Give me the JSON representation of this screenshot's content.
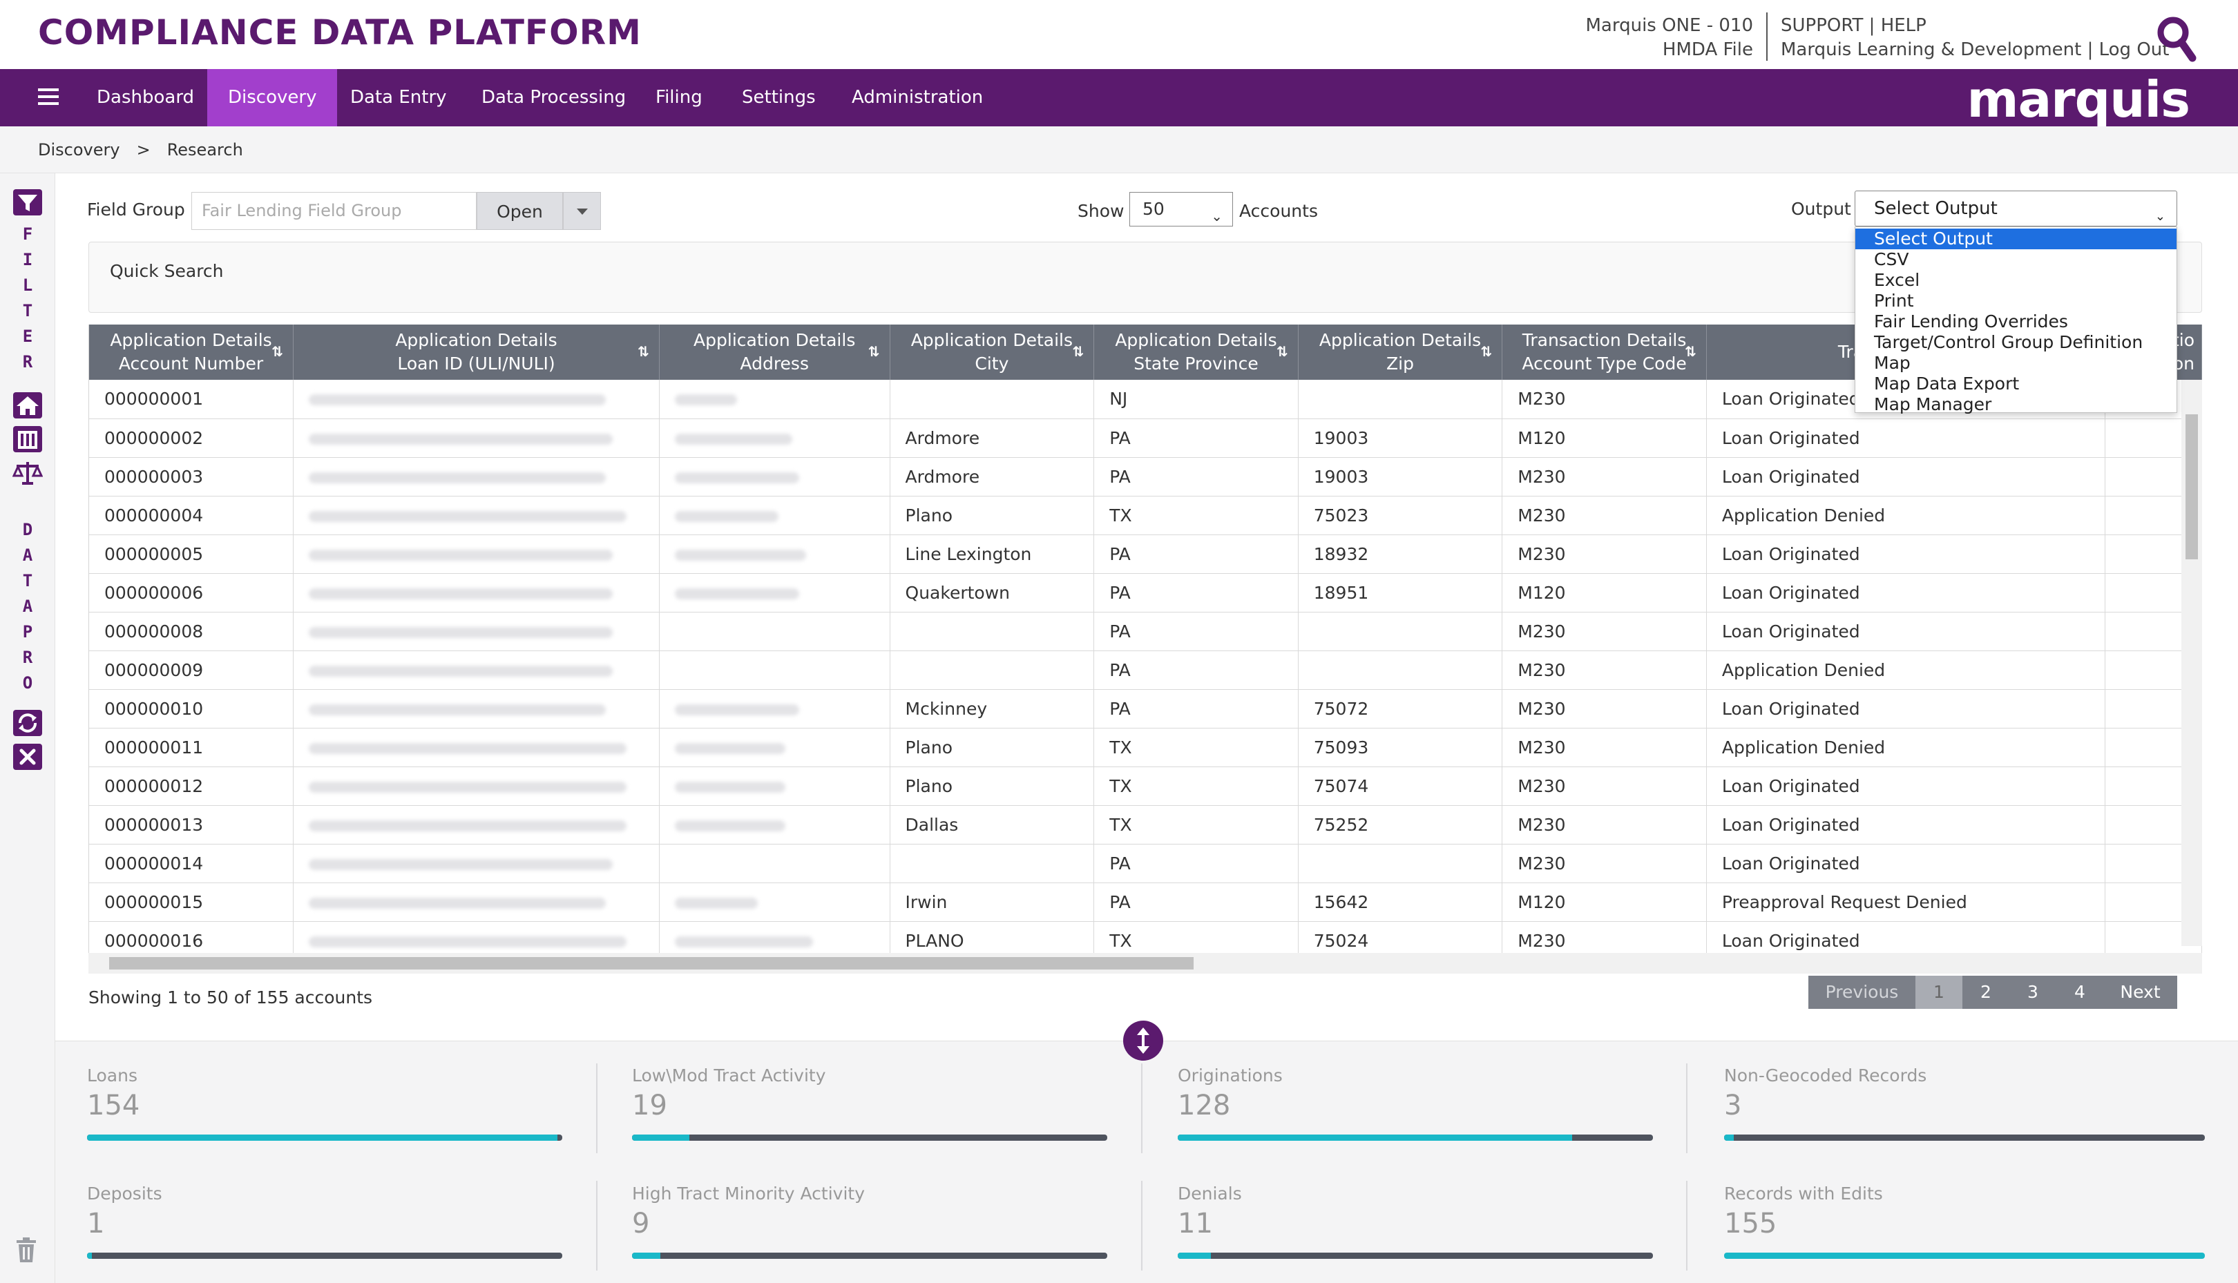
{
  "header": {
    "app_title": "COMPLIANCE DATA PLATFORM",
    "account_line1": "Marquis ONE - 010",
    "account_line2": "HMDA File",
    "links_line1": "SUPPORT | HELP",
    "links_line2": "Marquis Learning & Development | Log Out"
  },
  "nav": {
    "items": [
      {
        "label": "Dashboard"
      },
      {
        "label": "Discovery"
      },
      {
        "label": "Data Entry"
      },
      {
        "label": "Data Processing"
      },
      {
        "label": "Filing"
      },
      {
        "label": "Settings"
      },
      {
        "label": "Administration"
      }
    ],
    "active": "Discovery",
    "brand": "marquis"
  },
  "breadcrumb": {
    "root": "Discovery",
    "separator": ">",
    "current": "Research"
  },
  "rail": {
    "filter_letters": [
      "F",
      "I",
      "L",
      "T",
      "E",
      "R"
    ],
    "datapro_letters": [
      "D",
      "A",
      "T",
      "A",
      "P",
      "R",
      "O"
    ]
  },
  "toolbar": {
    "field_group_label": "Field Group",
    "field_group_placeholder": "Fair Lending Field Group",
    "open_label": "Open",
    "show_label": "Show",
    "show_value": "50",
    "accounts_label": "Accounts",
    "output_label": "Output",
    "output_value": "Select Output"
  },
  "output_menu": {
    "options": [
      "Select Output",
      "CSV",
      "Excel",
      "Print",
      "Fair Lending Overrides",
      "Target/Control Group Definition",
      "Map",
      "Map Data Export",
      "Map Manager"
    ],
    "selected": "Select Output"
  },
  "quick_search": {
    "label": "Quick Search"
  },
  "table": {
    "columns": [
      {
        "line1": "Application Details",
        "line2": "Account Number"
      },
      {
        "line1": "Application Details",
        "line2": "Loan ID (ULI/NULI)"
      },
      {
        "line1": "Application Details",
        "line2": "Address"
      },
      {
        "line1": "Application Details",
        "line2": "City"
      },
      {
        "line1": "Application Details",
        "line2": "State Province"
      },
      {
        "line1": "Application Details",
        "line2": "Zip"
      },
      {
        "line1": "Transaction Details",
        "line2": "Account Type Code"
      },
      {
        "line1": "Tran",
        "line2": ""
      },
      {
        "line1": "ctio",
        "line2": "tion"
      }
    ],
    "rows": [
      {
        "acct": "000000001",
        "city": "",
        "state": "NJ",
        "zip": "",
        "type": "M230",
        "action": "Loan Originated"
      },
      {
        "acct": "000000002",
        "city": "Ardmore",
        "state": "PA",
        "zip": "19003",
        "type": "M120",
        "action": "Loan Originated"
      },
      {
        "acct": "000000003",
        "city": "Ardmore",
        "state": "PA",
        "zip": "19003",
        "type": "M230",
        "action": "Loan Originated"
      },
      {
        "acct": "000000004",
        "city": "Plano",
        "state": "TX",
        "zip": "75023",
        "type": "M230",
        "action": "Application Denied"
      },
      {
        "acct": "000000005",
        "city": "Line Lexington",
        "state": "PA",
        "zip": "18932",
        "type": "M230",
        "action": "Loan Originated"
      },
      {
        "acct": "000000006",
        "city": "Quakertown",
        "state": "PA",
        "zip": "18951",
        "type": "M120",
        "action": "Loan Originated"
      },
      {
        "acct": "000000008",
        "city": "",
        "state": "PA",
        "zip": "",
        "type": "M230",
        "action": "Loan Originated"
      },
      {
        "acct": "000000009",
        "city": "",
        "state": "PA",
        "zip": "",
        "type": "M230",
        "action": "Application Denied"
      },
      {
        "acct": "000000010",
        "city": "Mckinney",
        "state": "PA",
        "zip": "75072",
        "type": "M230",
        "action": "Loan Originated"
      },
      {
        "acct": "000000011",
        "city": "Plano",
        "state": "TX",
        "zip": "75093",
        "type": "M230",
        "action": "Application Denied"
      },
      {
        "acct": "000000012",
        "city": "Plano",
        "state": "TX",
        "zip": "75074",
        "type": "M230",
        "action": "Loan Originated"
      },
      {
        "acct": "000000013",
        "city": "Dallas",
        "state": "TX",
        "zip": "75252",
        "type": "M230",
        "action": "Loan Originated"
      },
      {
        "acct": "000000014",
        "city": "",
        "state": "PA",
        "zip": "",
        "type": "M230",
        "action": "Loan Originated"
      },
      {
        "acct": "000000015",
        "city": "Irwin",
        "state": "PA",
        "zip": "15642",
        "type": "M120",
        "action": "Preapproval Request Denied"
      },
      {
        "acct": "000000016",
        "city": "PLANO",
        "state": "TX",
        "zip": "75024",
        "type": "M230",
        "action": "Loan Originated"
      }
    ]
  },
  "footer": {
    "showing": "Showing 1 to 50 of 155 accounts",
    "pager": {
      "previous": "Previous",
      "pages": [
        "1",
        "2",
        "3",
        "4"
      ],
      "current": "1",
      "next": "Next"
    }
  },
  "stats": [
    {
      "title": "Loans",
      "value": "154",
      "fill": 0.99
    },
    {
      "title": "Low\\Mod Tract Activity",
      "value": "19",
      "fill": 0.12
    },
    {
      "title": "Originations",
      "value": "128",
      "fill": 0.83
    },
    {
      "title": "Non-Geocoded Records",
      "value": "3",
      "fill": 0.02
    },
    {
      "title": "Deposits",
      "value": "1",
      "fill": 0.01
    },
    {
      "title": "High Tract Minority Activity",
      "value": "9",
      "fill": 0.06
    },
    {
      "title": "Denials",
      "value": "11",
      "fill": 0.07
    },
    {
      "title": "Records with Edits",
      "value": "155",
      "fill": 1.0
    }
  ],
  "colors": {
    "brand_purple": "#5b1a6e",
    "nav_active": "#a23fcc",
    "stat_fill": "#1ab8c8",
    "stat_track": "#4e535e",
    "dropdown_highlight": "#1e6fe0"
  }
}
